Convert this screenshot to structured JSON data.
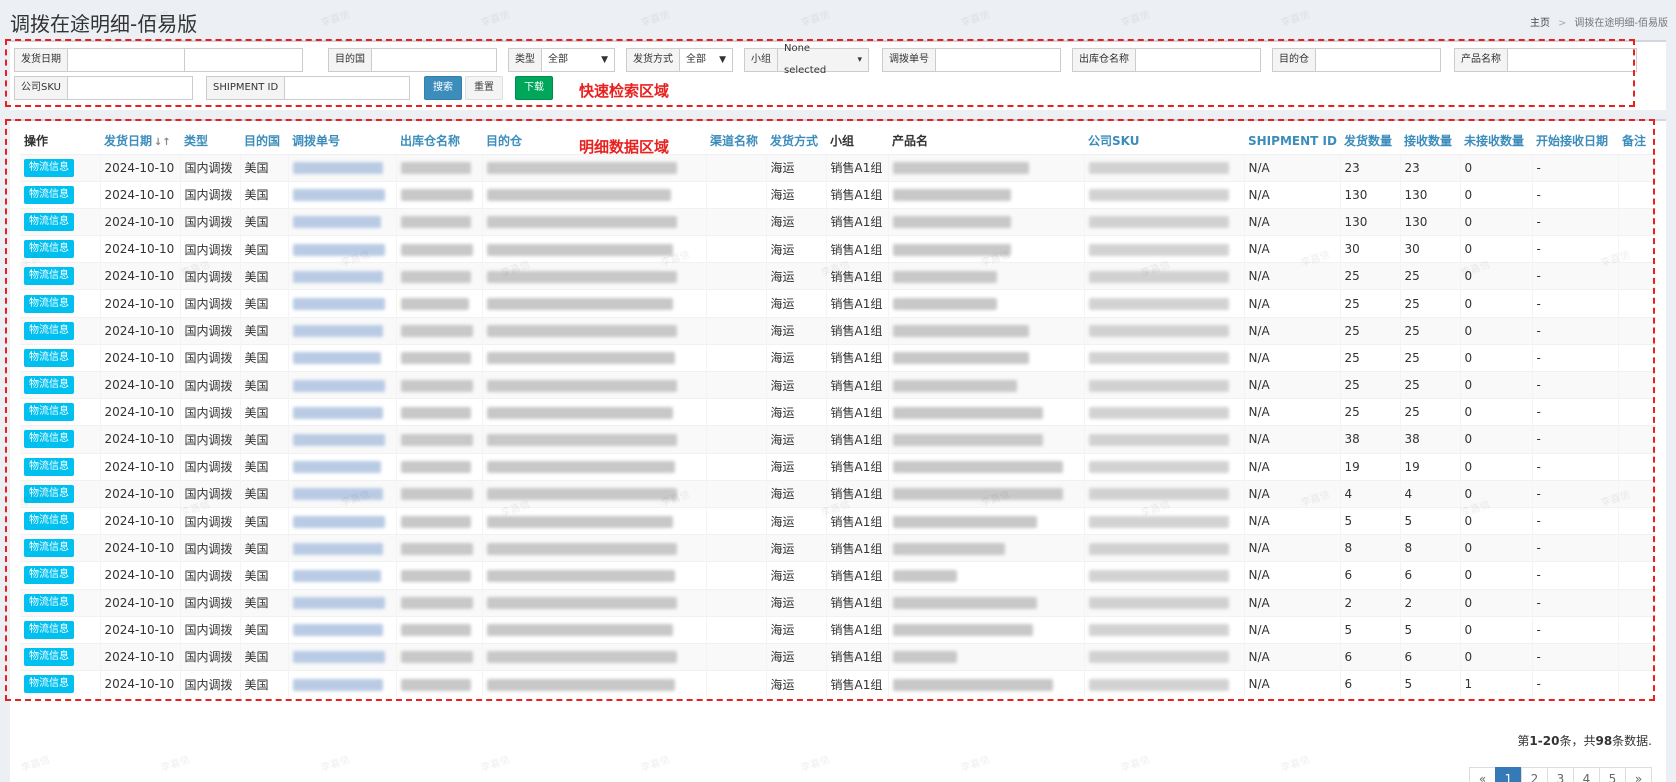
{
  "page": {
    "title": "调拨在途明细-佰易版",
    "breadcrumb": {
      "home": "主页",
      "separator": ">",
      "current": "调拨在途明细-佰易版"
    },
    "watermark_text": "李嘉信"
  },
  "filters": {
    "ship_date_label": "发货日期",
    "dest_country_label": "目的国",
    "type_label": "类型",
    "type_value": "全部",
    "ship_method_label": "发货方式",
    "ship_method_value": "全部",
    "group_label": "小组",
    "group_value": "None selected",
    "transfer_no_label": "调拨单号",
    "out_warehouse_label": "出库仓名称",
    "dest_warehouse_label": "目的仓",
    "product_name_label": "产品名称",
    "company_sku_label": "公司SKU",
    "shipment_id_label": "SHIPMENT ID",
    "search_button": "搜索",
    "reset_button": "重置",
    "download_button": "下载"
  },
  "annotations": {
    "quick_search": "快速检索区域",
    "detail_data": "明细数据区域"
  },
  "table": {
    "headers": [
      "操作",
      "发货日期",
      "类型",
      "目的国",
      "调拨单号",
      "出库仓名称",
      "目的仓",
      "渠道名称",
      "发货方式",
      "小组",
      "产品名",
      "公司SKU",
      "SHIPMENT ID",
      "发货数量",
      "接收数量",
      "未接收数量",
      "开始接收日期",
      "备注"
    ],
    "action_label": "物流信息",
    "rows": [
      {
        "date": "2024-10-10",
        "type": "国内调拨",
        "country": "美国",
        "method": "海运",
        "group": "销售A1组",
        "shipment_id": "N/A",
        "sent": "23",
        "received": "23",
        "pending": "0",
        "start_date": "-"
      },
      {
        "date": "2024-10-10",
        "type": "国内调拨",
        "country": "美国",
        "method": "海运",
        "group": "销售A1组",
        "shipment_id": "N/A",
        "sent": "130",
        "received": "130",
        "pending": "0",
        "start_date": "-"
      },
      {
        "date": "2024-10-10",
        "type": "国内调拨",
        "country": "美国",
        "method": "海运",
        "group": "销售A1组",
        "shipment_id": "N/A",
        "sent": "130",
        "received": "130",
        "pending": "0",
        "start_date": "-"
      },
      {
        "date": "2024-10-10",
        "type": "国内调拨",
        "country": "美国",
        "method": "海运",
        "group": "销售A1组",
        "shipment_id": "N/A",
        "sent": "30",
        "received": "30",
        "pending": "0",
        "start_date": "-"
      },
      {
        "date": "2024-10-10",
        "type": "国内调拨",
        "country": "美国",
        "method": "海运",
        "group": "销售A1组",
        "shipment_id": "N/A",
        "sent": "25",
        "received": "25",
        "pending": "0",
        "start_date": "-"
      },
      {
        "date": "2024-10-10",
        "type": "国内调拨",
        "country": "美国",
        "method": "海运",
        "group": "销售A1组",
        "shipment_id": "N/A",
        "sent": "25",
        "received": "25",
        "pending": "0",
        "start_date": "-"
      },
      {
        "date": "2024-10-10",
        "type": "国内调拨",
        "country": "美国",
        "method": "海运",
        "group": "销售A1组",
        "shipment_id": "N/A",
        "sent": "25",
        "received": "25",
        "pending": "0",
        "start_date": "-"
      },
      {
        "date": "2024-10-10",
        "type": "国内调拨",
        "country": "美国",
        "method": "海运",
        "group": "销售A1组",
        "shipment_id": "N/A",
        "sent": "25",
        "received": "25",
        "pending": "0",
        "start_date": "-"
      },
      {
        "date": "2024-10-10",
        "type": "国内调拨",
        "country": "美国",
        "method": "海运",
        "group": "销售A1组",
        "shipment_id": "N/A",
        "sent": "25",
        "received": "25",
        "pending": "0",
        "start_date": "-"
      },
      {
        "date": "2024-10-10",
        "type": "国内调拨",
        "country": "美国",
        "method": "海运",
        "group": "销售A1组",
        "shipment_id": "N/A",
        "sent": "25",
        "received": "25",
        "pending": "0",
        "start_date": "-"
      },
      {
        "date": "2024-10-10",
        "type": "国内调拨",
        "country": "美国",
        "method": "海运",
        "group": "销售A1组",
        "shipment_id": "N/A",
        "sent": "38",
        "received": "38",
        "pending": "0",
        "start_date": "-"
      },
      {
        "date": "2024-10-10",
        "type": "国内调拨",
        "country": "美国",
        "method": "海运",
        "group": "销售A1组",
        "shipment_id": "N/A",
        "sent": "19",
        "received": "19",
        "pending": "0",
        "start_date": "-"
      },
      {
        "date": "2024-10-10",
        "type": "国内调拨",
        "country": "美国",
        "method": "海运",
        "group": "销售A1组",
        "shipment_id": "N/A",
        "sent": "4",
        "received": "4",
        "pending": "0",
        "start_date": "-"
      },
      {
        "date": "2024-10-10",
        "type": "国内调拨",
        "country": "美国",
        "method": "海运",
        "group": "销售A1组",
        "shipment_id": "N/A",
        "sent": "5",
        "received": "5",
        "pending": "0",
        "start_date": "-"
      },
      {
        "date": "2024-10-10",
        "type": "国内调拨",
        "country": "美国",
        "method": "海运",
        "group": "销售A1组",
        "shipment_id": "N/A",
        "sent": "8",
        "received": "8",
        "pending": "0",
        "start_date": "-"
      },
      {
        "date": "2024-10-10",
        "type": "国内调拨",
        "country": "美国",
        "method": "海运",
        "group": "销售A1组",
        "shipment_id": "N/A",
        "sent": "6",
        "received": "6",
        "pending": "0",
        "start_date": "-"
      },
      {
        "date": "2024-10-10",
        "type": "国内调拨",
        "country": "美国",
        "method": "海运",
        "group": "销售A1组",
        "shipment_id": "N/A",
        "sent": "2",
        "received": "2",
        "pending": "0",
        "start_date": "-"
      },
      {
        "date": "2024-10-10",
        "type": "国内调拨",
        "country": "美国",
        "method": "海运",
        "group": "销售A1组",
        "shipment_id": "N/A",
        "sent": "5",
        "received": "5",
        "pending": "0",
        "start_date": "-"
      },
      {
        "date": "2024-10-10",
        "type": "国内调拨",
        "country": "美国",
        "method": "海运",
        "group": "销售A1组",
        "shipment_id": "N/A",
        "sent": "6",
        "received": "6",
        "pending": "0",
        "start_date": "-"
      },
      {
        "date": "2024-10-10",
        "type": "国内调拨",
        "country": "美国",
        "method": "海运",
        "group": "销售A1组",
        "shipment_id": "N/A",
        "sent": "6",
        "received": "5",
        "pending": "1",
        "start_date": "-"
      }
    ]
  },
  "summary": {
    "prefix": "第",
    "range": "1-20",
    "middle": "条，共",
    "total": "98",
    "suffix": "条数据."
  },
  "pagination": {
    "prev": "«",
    "pages": [
      "1",
      "2",
      "3",
      "4",
      "5"
    ],
    "next": "»",
    "active": "1"
  }
}
